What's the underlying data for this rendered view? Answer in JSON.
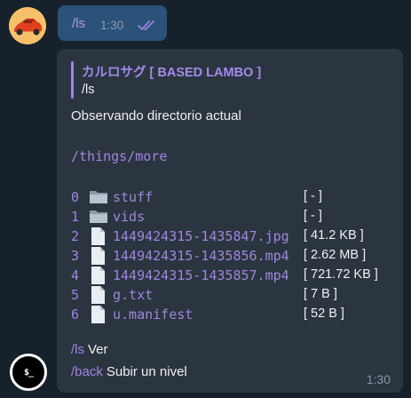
{
  "outgoing": {
    "text": "/ls",
    "time": "1:30"
  },
  "reply": {
    "quote_author": "カルロサグ [ BASED LAMBO ]",
    "quote_text": "/ls",
    "observe_label": "Observando directorio actual",
    "path": "/things/more",
    "files": [
      {
        "index": "0",
        "type": "folder",
        "name": "stuff",
        "size": "[ - ]"
      },
      {
        "index": "1",
        "type": "folder",
        "name": "vids",
        "size": "[ - ]"
      },
      {
        "index": "2",
        "type": "file",
        "name": "1449424315-1435847.jpg",
        "size": "[ 41.2 KB ]"
      },
      {
        "index": "3",
        "type": "file",
        "name": "1449424315-1435856.mp4",
        "size": "[ 2.62 MB ]"
      },
      {
        "index": "4",
        "type": "file",
        "name": "1449424315-1435857.mp4",
        "size": "[ 721.72 KB ]"
      },
      {
        "index": "5",
        "type": "file",
        "name": "g.txt",
        "size": "[ 7 B ]"
      },
      {
        "index": "6",
        "type": "file",
        "name": "u.manifest",
        "size": "[ 52 B ]"
      }
    ],
    "commands": [
      {
        "cmd": "/ls",
        "desc": "Ver"
      },
      {
        "cmd": "/back",
        "desc": "Subir un nivel"
      }
    ],
    "time": "1:30"
  },
  "bot_avatar_glyph": "$_",
  "colors": {
    "background": "#17212b",
    "outgoing_bubble": "#2b5278",
    "incoming_bubble": "#2b3540",
    "accent": "#9f86df"
  },
  "icons": {
    "folder": "folder-icon",
    "file": "file-icon",
    "read_receipt": "double-check-icon"
  }
}
